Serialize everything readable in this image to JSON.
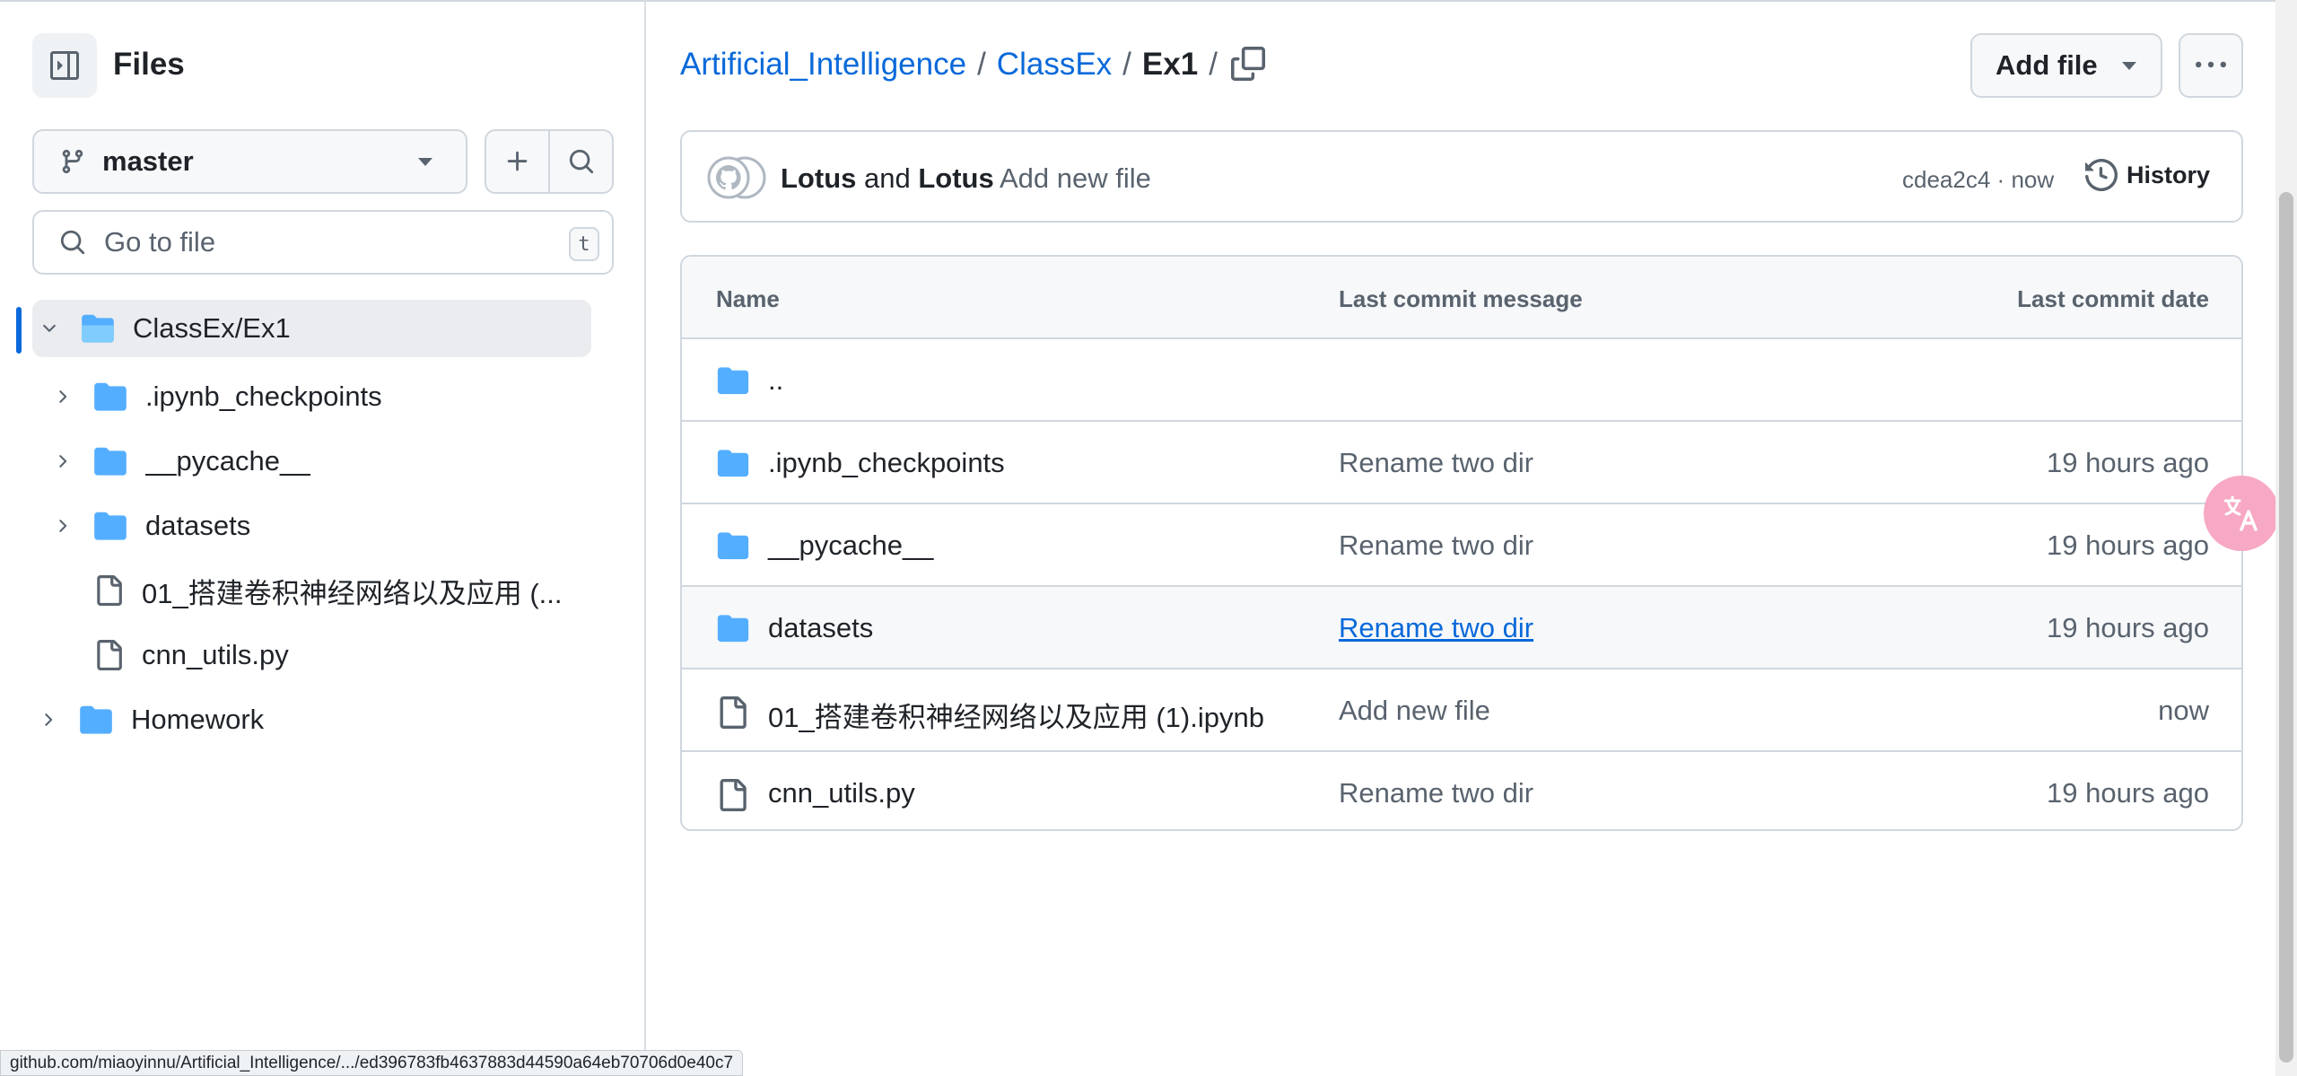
{
  "sidebar": {
    "title": "Files",
    "branch": "master",
    "search_placeholder": "Go to file",
    "search_shortcut": "t",
    "tree": [
      {
        "label": "ClassEx/Ex1",
        "type": "folder",
        "expanded": true,
        "active": true
      },
      {
        "label": ".ipynb_checkpoints",
        "type": "folder"
      },
      {
        "label": "__pycache__",
        "type": "folder"
      },
      {
        "label": "datasets",
        "type": "folder"
      },
      {
        "label": "01_搭建卷积神经网络以及应用 (...",
        "type": "file"
      },
      {
        "label": "cnn_utils.py",
        "type": "file"
      },
      {
        "label": "Homework",
        "type": "folder"
      }
    ]
  },
  "breadcrumb": {
    "repo": "Artificial_Intelligence",
    "folder": "ClassEx",
    "current": "Ex1",
    "sep": "/"
  },
  "toolbar": {
    "add_file_label": "Add file"
  },
  "commit": {
    "author1": "Lotus",
    "conj": "and",
    "author2": "Lotus",
    "message": "Add new file",
    "hash": "cdea2c4",
    "dot": "·",
    "time": "now",
    "history_label": "History"
  },
  "table": {
    "headers": [
      "Name",
      "Last commit message",
      "Last commit date"
    ],
    "rows": [
      {
        "name": "..",
        "message": "",
        "date": "",
        "type": "folder"
      },
      {
        "name": ".ipynb_checkpoints",
        "message": "Rename two dir",
        "date": "19 hours ago",
        "type": "folder"
      },
      {
        "name": "__pycache__",
        "message": "Rename two dir",
        "date": "19 hours ago",
        "type": "folder"
      },
      {
        "name": "datasets",
        "message": "Rename two dir",
        "date": "19 hours ago",
        "type": "folder"
      },
      {
        "name": "01_搭建卷积神经网络以及应用 (1).ipynb",
        "message": "Add new file",
        "date": "now",
        "type": "file"
      },
      {
        "name": "cnn_utils.py",
        "message": "Rename two dir",
        "date": "19 hours ago",
        "type": "file"
      }
    ]
  },
  "status_url": "github.com/miaoyinnu/Artificial_Intelligence/.../ed396783fb4637883d44590a64eb70706d0e40c7",
  "colors": {
    "link": "#0969da",
    "folder": "#54aeff",
    "border": "#d0d7de",
    "muted": "#59636e"
  }
}
